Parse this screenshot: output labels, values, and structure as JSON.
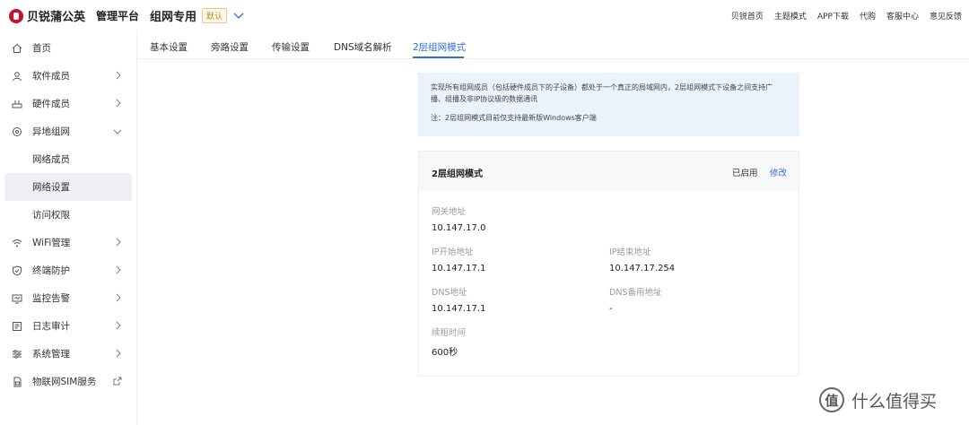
{
  "header": {
    "logo_text": "贝锐蒲公英",
    "platform": "管理平台",
    "group_name": "组网专用",
    "group_badge": "默认",
    "links": [
      "贝锐首页",
      "主题模式",
      "APP下载",
      "代购",
      "客服中心",
      "意见反馈"
    ]
  },
  "sidebar": {
    "items": [
      {
        "label": "首页",
        "icon": "home-icon"
      },
      {
        "label": "软件成员",
        "icon": "user-icon"
      },
      {
        "label": "硬件成员",
        "icon": "router-icon"
      },
      {
        "label": "异地组网",
        "icon": "network-icon"
      },
      {
        "label": "网络成员"
      },
      {
        "label": "网络设置"
      },
      {
        "label": "访问权限"
      },
      {
        "label": "WiFi管理",
        "icon": "wifi-icon"
      },
      {
        "label": "终端防护",
        "icon": "shield-icon"
      },
      {
        "label": "监控告警",
        "icon": "monitor-icon"
      },
      {
        "label": "日志审计",
        "icon": "log-icon"
      },
      {
        "label": "系统管理",
        "icon": "settings-icon"
      },
      {
        "label": "物联网SIM服务",
        "icon": "sim-icon"
      }
    ]
  },
  "tabs": [
    "基本设置",
    "旁路设置",
    "传输设置",
    "DNS域名解析",
    "2层组网模式"
  ],
  "info": {
    "line1": "实现所有组网成员（包括硬件成员下的子设备）都处于一个真正的局域网内，2层组网模式下设备之间支持广播、组播及非IP协议级的数据通讯",
    "line2": "注：2层组网模式目前仅支持最新版Windows客户端"
  },
  "card": {
    "title": "2层组网模式",
    "status": "已启用",
    "edit": "修改",
    "fields": {
      "gateway_label": "网关地址",
      "gateway_value": "10.147.17.0",
      "ip_start_label": "IP开始地址",
      "ip_start_value": "10.147.17.1",
      "ip_end_label": "IP结束地址",
      "ip_end_value": "10.147.17.254",
      "dns_label": "DNS地址",
      "dns_value": "10.147.17.1",
      "dns_backup_label": "DNS备用地址",
      "dns_backup_value": "-",
      "lease_label": "续租时间",
      "lease_value": "600秒"
    }
  },
  "watermark": "什么值得买",
  "colors": {
    "accent": "#2f6fd6",
    "brand": "#c8102e",
    "info_bg": "#eaf2fb"
  }
}
